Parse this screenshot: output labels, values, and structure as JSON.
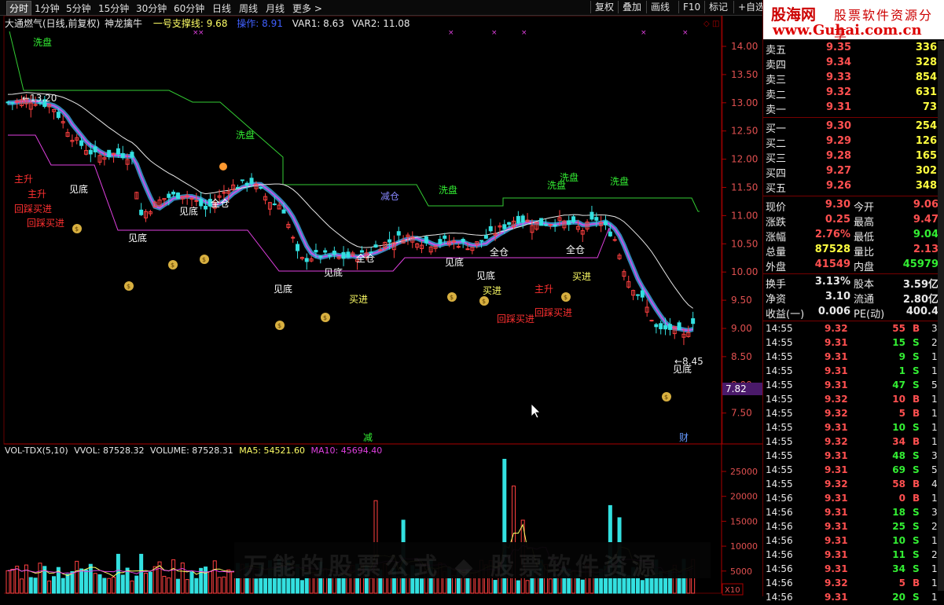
{
  "toolbar": {
    "timeframes": [
      "分时",
      "1分钟",
      "5分钟",
      "15分钟",
      "30分钟",
      "60分钟",
      "日线",
      "周线",
      "月线",
      "更多 >"
    ],
    "active_index": 0,
    "right_buttons": [
      "复权",
      "叠加",
      "画线",
      "F10",
      "标记",
      "+自选"
    ]
  },
  "chart_header": {
    "name": "大通燃气(日线,前复权)",
    "indicator": "神龙擒牛",
    "support_label": "一号支撑线:",
    "support_value": "9.68",
    "op_label": "操作:",
    "op_value": "8.91",
    "var1": "VAR1: 8.63",
    "var2": "VAR2: 11.08"
  },
  "volume_header": {
    "name": "VOL-TDX(5,10)",
    "vvol": "VVOL: 87528.32",
    "volume": "VOLUME: 87528.31",
    "ma5": "MA5: 54521.60",
    "ma10": "MA10: 45694.40"
  },
  "price_axis": [
    "14.00",
    "13.50",
    "13.00",
    "12.50",
    "12.00",
    "11.50",
    "11.00",
    "10.50",
    "10.00",
    "9.50",
    "9.00",
    "8.50",
    "8.00",
    "7.50"
  ],
  "current_price_tag": "7.82",
  "volume_axis": [
    "25000",
    "20000",
    "15000",
    "10000",
    "5000"
  ],
  "volume_axis_unit": "X10",
  "annotations": {
    "xipan": "洗盘",
    "jiandi": "见底",
    "zhusheng": "主升",
    "huicai": "回踩买进",
    "quancang": "全仓",
    "jiancang": "减仓",
    "mairu": "买进",
    "jian": "减",
    "cai": "财",
    "high_mark": "13.20",
    "low_mark": "8.45"
  },
  "colors": {
    "up": "#ff4040",
    "down": "#33e0e0",
    "ma_white": "#e8e8e8",
    "green_line": "#33cc33",
    "magenta_line": "#e040e0",
    "band_blue": "#3aa0d8",
    "band_magenta": "#ff40ff",
    "axis_red": "#a00000"
  },
  "logo": {
    "name": "股海网",
    "slogan": "股票软件资源分享",
    "url": "www.Guhai.com.cn"
  },
  "orderbook": {
    "sells": [
      {
        "label": "卖五",
        "price": "9.35",
        "vol": "336"
      },
      {
        "label": "卖四",
        "price": "9.34",
        "vol": "328"
      },
      {
        "label": "卖三",
        "price": "9.33",
        "vol": "854"
      },
      {
        "label": "卖二",
        "price": "9.32",
        "vol": "631"
      },
      {
        "label": "卖一",
        "price": "9.31",
        "vol": "73"
      }
    ],
    "buys": [
      {
        "label": "买一",
        "price": "9.30",
        "vol": "254"
      },
      {
        "label": "买二",
        "price": "9.29",
        "vol": "126"
      },
      {
        "label": "买三",
        "price": "9.28",
        "vol": "165"
      },
      {
        "label": "买四",
        "price": "9.27",
        "vol": "302"
      },
      {
        "label": "买五",
        "price": "9.26",
        "vol": "348"
      }
    ]
  },
  "stats": [
    {
      "l1": "现价",
      "v1": "9.30",
      "l2": "今开",
      "v2": "9.06"
    },
    {
      "l1": "涨跌",
      "v1": "0.25",
      "l2": "最高",
      "v2": "9.47"
    },
    {
      "l1": "涨幅",
      "v1": "2.76%",
      "l2": "最低",
      "v2": "9.04"
    },
    {
      "l1": "总量",
      "v1": "87528",
      "l2": "量比",
      "v2": "2.13"
    },
    {
      "l1": "外盘",
      "v1": "41549",
      "l2": "内盘",
      "v2": "45979"
    }
  ],
  "stats2": [
    {
      "l1": "换手",
      "v1": "3.13%",
      "l2": "股本",
      "v2": "3.59亿"
    },
    {
      "l1": "净资",
      "v1": "3.10",
      "l2": "流通",
      "v2": "2.80亿"
    },
    {
      "l1": "收益(一)",
      "v1": "0.006",
      "l2": "PE(动)",
      "v2": "400.4"
    }
  ],
  "trades": [
    {
      "t": "14:55",
      "p": "9.32",
      "v": "55",
      "s": "B",
      "n": "3"
    },
    {
      "t": "14:55",
      "p": "9.31",
      "v": "15",
      "s": "S",
      "n": "2"
    },
    {
      "t": "14:55",
      "p": "9.31",
      "v": "9",
      "s": "S",
      "n": "1"
    },
    {
      "t": "14:55",
      "p": "9.31",
      "v": "1",
      "s": "S",
      "n": "1"
    },
    {
      "t": "14:55",
      "p": "9.31",
      "v": "47",
      "s": "S",
      "n": "5"
    },
    {
      "t": "14:55",
      "p": "9.32",
      "v": "10",
      "s": "B",
      "n": "1"
    },
    {
      "t": "14:55",
      "p": "9.32",
      "v": "5",
      "s": "B",
      "n": "1"
    },
    {
      "t": "14:55",
      "p": "9.31",
      "v": "10",
      "s": "S",
      "n": "1"
    },
    {
      "t": "14:55",
      "p": "9.32",
      "v": "34",
      "s": "B",
      "n": "1"
    },
    {
      "t": "14:55",
      "p": "9.31",
      "v": "48",
      "s": "S",
      "n": "3"
    },
    {
      "t": "14:55",
      "p": "9.31",
      "v": "69",
      "s": "S",
      "n": "5"
    },
    {
      "t": "14:55",
      "p": "9.32",
      "v": "58",
      "s": "B",
      "n": "4"
    },
    {
      "t": "14:56",
      "p": "9.31",
      "v": "0",
      "s": "B",
      "n": "1"
    },
    {
      "t": "14:56",
      "p": "9.31",
      "v": "18",
      "s": "S",
      "n": "3"
    },
    {
      "t": "14:56",
      "p": "9.31",
      "v": "25",
      "s": "S",
      "n": "2"
    },
    {
      "t": "14:56",
      "p": "9.31",
      "v": "10",
      "s": "S",
      "n": "1"
    },
    {
      "t": "14:56",
      "p": "9.31",
      "v": "11",
      "s": "S",
      "n": "2"
    },
    {
      "t": "14:56",
      "p": "9.31",
      "v": "34",
      "s": "S",
      "n": "1"
    },
    {
      "t": "14:56",
      "p": "9.32",
      "v": "5",
      "s": "B",
      "n": "1"
    },
    {
      "t": "14:56",
      "p": "9.31",
      "v": "20",
      "s": "S",
      "n": "1"
    }
  ],
  "watermark": "万能的股票公式 ◆ 股票软件资源"
}
